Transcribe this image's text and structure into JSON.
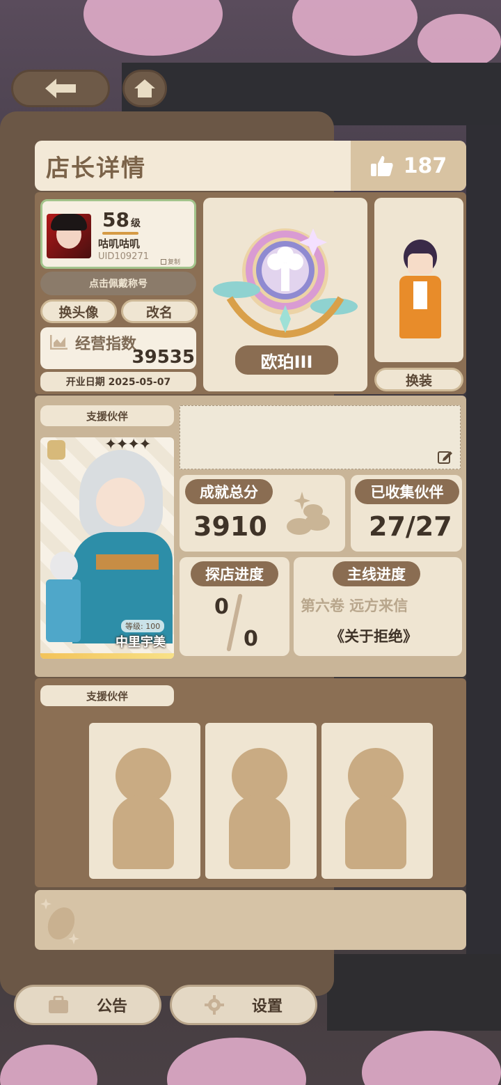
{
  "header": {
    "title": "店长详情",
    "like_count": "187"
  },
  "profile": {
    "level": "58",
    "level_suffix": "级",
    "name": "咕叽咕叽",
    "uid": "UID109271",
    "copy_label": "复制",
    "title_button": "点击佩戴称号",
    "change_avatar": "换头像",
    "rename": "改名",
    "business_index_label": "经营指数",
    "business_index_value": "39535",
    "open_date": "开业日期 2025-05-07"
  },
  "rank": {
    "badge_label": "欧珀III"
  },
  "outfit": {
    "change_outfit": "换装"
  },
  "support_partner": {
    "section_label": "支援伙伴",
    "level_text": "等级: 100",
    "name": "中里宇美",
    "stars": "✦✦✦✦"
  },
  "stats": {
    "achievement_label": "成就总分",
    "achievement_value": "3910",
    "collected_label": "已收集伙伴",
    "collected_value": "27/27",
    "explore_label": "探店进度",
    "explore_current": "0",
    "explore_total": "0",
    "story_label": "主线进度",
    "story_chapter": "第六卷 远方来信",
    "story_title": "《关于拒绝》"
  },
  "support_slots": {
    "section_label": "支援伙伴"
  },
  "footer": {
    "notice": "公告",
    "settings": "设置"
  },
  "colors": {
    "cream": "#efe5d2",
    "brown": "#8b6f54",
    "tag_brown": "#8a6d52",
    "text_dark": "#3f3328"
  }
}
